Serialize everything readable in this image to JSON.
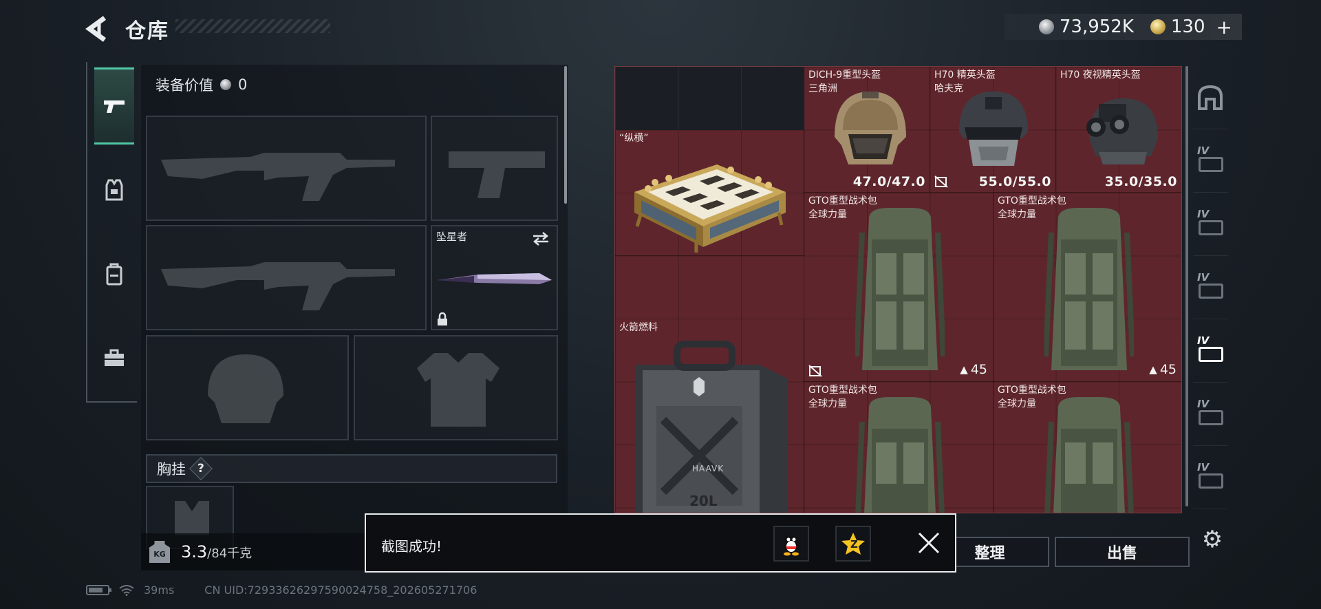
{
  "header": {
    "title": "仓库",
    "currency": [
      {
        "name": "silver-coin-icon",
        "value": "73,952K"
      },
      {
        "name": "gold-coin-icon",
        "value": "130"
      }
    ],
    "add_symbol": "+"
  },
  "left_nav": {
    "items": [
      {
        "name": "nav-weapons",
        "icon": "pistol-icon",
        "active": true
      },
      {
        "name": "nav-armor",
        "icon": "vest-icon",
        "active": false
      },
      {
        "name": "nav-backpack",
        "icon": "backpack-icon",
        "active": false
      },
      {
        "name": "nav-toolkit",
        "icon": "toolbox-icon",
        "active": false
      }
    ]
  },
  "equipment": {
    "value_label": "装备价值",
    "value": "0",
    "melee_name": "坠星者",
    "chest_label": "胸挂",
    "chest_help": "?",
    "weight_current": "3.3",
    "weight_max": "/84千克",
    "weight_icon_text": "KG"
  },
  "storage": {
    "items": [
      {
        "id": "chess",
        "name": "“纵横”",
        "sub": ""
      },
      {
        "id": "helmet1",
        "name": "DICH-9重型头盔",
        "sub": "三角洲",
        "durability": "47.0/47.0"
      },
      {
        "id": "helmet2",
        "name": "H70 精英头盔",
        "sub": "哈夫克",
        "durability": "55.0/55.0"
      },
      {
        "id": "helmet3",
        "name": "H70 夜视精英头盔",
        "sub": "",
        "durability": "35.0/35.0"
      },
      {
        "id": "fuel",
        "name": "火箭燃料",
        "sub": "",
        "can_text": "20L",
        "brand": "HAAVK"
      },
      {
        "id": "bag1",
        "name": "GTO重型战术包",
        "sub": "全球力量",
        "qty": "45"
      },
      {
        "id": "bag2",
        "name": "GTO重型战术包",
        "sub": "全球力量",
        "qty": "45"
      },
      {
        "id": "bag3",
        "name": "GTO重型战术包",
        "sub": "全球力量"
      },
      {
        "id": "bag4",
        "name": "GTO重型战术包",
        "sub": "全球力量"
      }
    ]
  },
  "categories": [
    {
      "label": "",
      "icon": "helmet-icon"
    },
    {
      "label": "IV",
      "icon": "category-iv-icon"
    },
    {
      "label": "IV",
      "icon": "category-iv-icon"
    },
    {
      "label": "IV",
      "icon": "category-iv-icon"
    },
    {
      "label": "IV",
      "icon": "category-iv-icon",
      "active": true
    },
    {
      "label": "IV",
      "icon": "category-iv-icon"
    },
    {
      "label": "IV",
      "icon": "category-iv-icon"
    }
  ],
  "buttons": {
    "sort": "整理",
    "sell": "出售"
  },
  "toast": {
    "text": "截图成功!",
    "share_qq_icon": "qq-penguin-icon",
    "share_qzone_icon": "qzone-star-icon",
    "qzone_badge": "Z"
  },
  "status_bar": {
    "ping": "39ms",
    "uid": "CN UID:7293362629759002​4758_202605271706"
  },
  "colors": {
    "accent": "#51c7a8",
    "storage_bg": "#5e262c"
  }
}
